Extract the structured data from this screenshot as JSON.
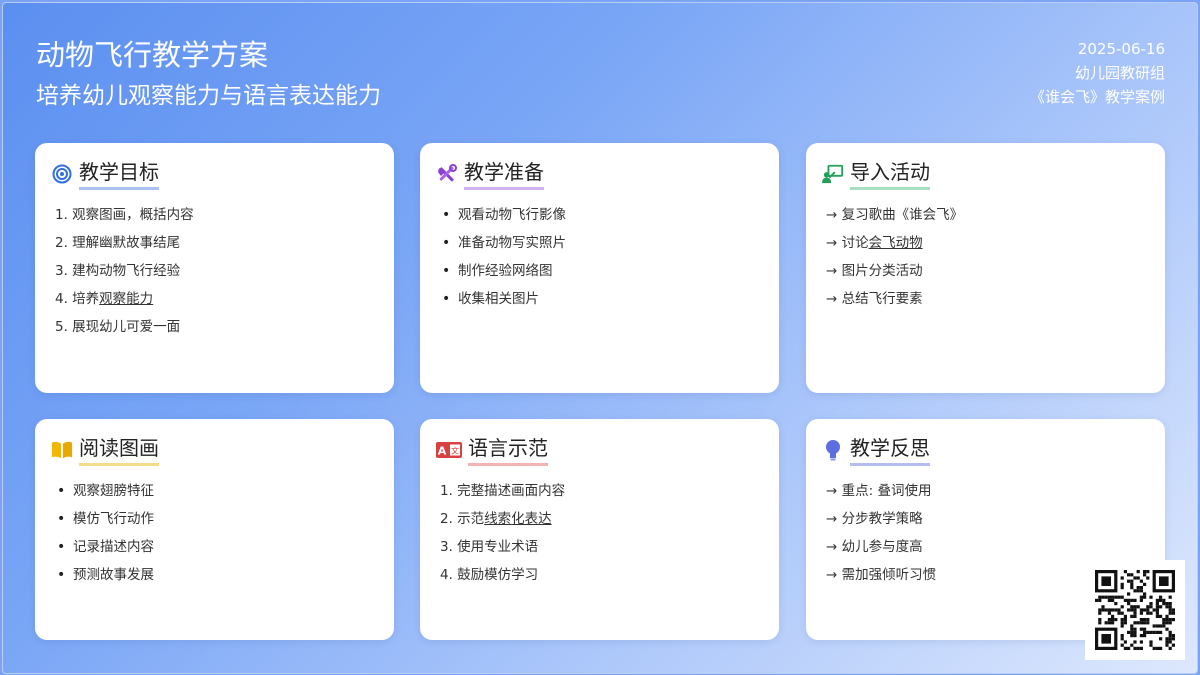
{
  "header": {
    "title": "动物飞行教学方案",
    "subtitle": "培养幼儿观察能力与语言表达能力",
    "date": "2025-06-16",
    "group": "幼儿园教研组",
    "case": "《谁会飞》教学案例"
  },
  "cards": {
    "goals": {
      "title": "教学目标",
      "icon": "target-icon",
      "items": [
        {
          "pre": "1. 观察图画，概括内容",
          "u": ""
        },
        {
          "pre": "2. 理解幽默故事结尾",
          "u": ""
        },
        {
          "pre": "3. 建构动物飞行经验",
          "u": ""
        },
        {
          "pre": "4. 培养",
          "u": "观察能力"
        },
        {
          "pre": "5. 展现幼儿可爱一面",
          "u": ""
        }
      ]
    },
    "prep": {
      "title": "教学准备",
      "icon": "tools-icon",
      "items": [
        "观看动物飞行影像",
        "准备动物写实照片",
        "制作经验网络图",
        "收集相关图片"
      ]
    },
    "intro": {
      "title": "导入活动",
      "icon": "presentation-icon",
      "items": [
        {
          "pre": "→ 复习歌曲《谁会飞》",
          "u": ""
        },
        {
          "pre": "→ 讨论",
          "u": "会飞动物"
        },
        {
          "pre": "→ 图片分类活动",
          "u": ""
        },
        {
          "pre": "→ 总结飞行要素",
          "u": ""
        }
      ]
    },
    "reading": {
      "title": "阅读图画",
      "icon": "book-icon",
      "items": [
        "观察翅膀特征",
        "模仿飞行动作",
        "记录描述内容",
        "预测故事发展"
      ]
    },
    "language": {
      "title": "语言示范",
      "icon": "translate-icon",
      "items": [
        {
          "pre": "1. 完整描述画面内容",
          "u": ""
        },
        {
          "pre": "2. 示范",
          "u": "线索化表达"
        },
        {
          "pre": "3. 使用专业术语",
          "u": ""
        },
        {
          "pre": "4. 鼓励模仿学习",
          "u": ""
        }
      ]
    },
    "reflection": {
      "title": "教学反思",
      "icon": "lightbulb-icon",
      "items": [
        {
          "pre": "→ 重点: 叠词使用",
          "u": ""
        },
        {
          "pre": "→ 分步教学策略",
          "u": ""
        },
        {
          "pre": "→ 幼儿参与度高",
          "u": ""
        },
        {
          "pre": "→ 需加强倾听习惯",
          "u": ""
        }
      ]
    }
  },
  "qr": {
    "icon": "qr-code-icon"
  }
}
